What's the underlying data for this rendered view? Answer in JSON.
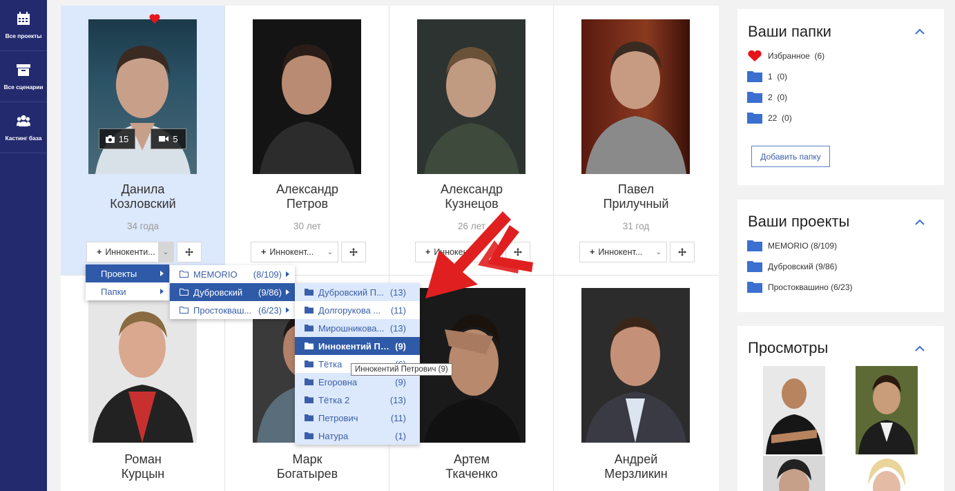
{
  "sidebar": {
    "items": [
      {
        "label": "Все проекты",
        "icon": "calendar-icon"
      },
      {
        "label": "Все сценарии",
        "icon": "archive-icon"
      },
      {
        "label": "Кастинг база",
        "icon": "users-icon"
      }
    ]
  },
  "actors": [
    {
      "name1": "Данила",
      "name2": "Козловский",
      "age": "34 года",
      "photos": "15",
      "videos": "5",
      "favorite": true
    },
    {
      "name1": "Александр",
      "name2": "Петров",
      "age": "30 лет"
    },
    {
      "name1": "Александр",
      "name2": "Кузнецов",
      "age": "26 лет"
    },
    {
      "name1": "Павел",
      "name2": "Прилучный",
      "age": "31 год"
    },
    {
      "name1": "Роман",
      "name2": "Курцын"
    },
    {
      "name1": "Марк",
      "name2": "Богатырев"
    },
    {
      "name1": "Артем",
      "name2": "Ткаченко"
    },
    {
      "name1": "Андрей",
      "name2": "Мерзликин"
    }
  ],
  "add_select_label": "Иннокенти...",
  "add_select_label2": "Иннокент...",
  "menu_level1": [
    {
      "label": "Проекты"
    },
    {
      "label": "Папки"
    }
  ],
  "menu_level2": [
    {
      "label": "MEMORIO",
      "count": "(8/109)"
    },
    {
      "label": "Дубровский",
      "count": "(9/86)"
    },
    {
      "label": "Простокваш...",
      "count": "(6/23)"
    }
  ],
  "menu_level3": [
    {
      "label": "Дубровский П...",
      "count": "(13)"
    },
    {
      "label": "Долгорукова ...",
      "count": "(11)"
    },
    {
      "label": "Мирошникова...",
      "count": "(13)"
    },
    {
      "label": "Иннокентий Пе...",
      "count": "(9)"
    },
    {
      "label": "Тётка",
      "count": "(6)"
    },
    {
      "label": "Егоровна",
      "count": "(9)"
    },
    {
      "label": "Тётка 2",
      "count": "(13)"
    },
    {
      "label": "Петрович",
      "count": "(11)"
    },
    {
      "label": "Натура",
      "count": "(1)"
    }
  ],
  "tooltip": "Иннокентий Петрович (9)",
  "folders_panel": {
    "title": "Ваши папки",
    "items": [
      {
        "label": "Избранное",
        "count": "(6)",
        "icon": "heart-icon"
      },
      {
        "label": "1",
        "count": "(0)",
        "icon": "folder-icon"
      },
      {
        "label": "2",
        "count": "(0)",
        "icon": "folder-icon"
      },
      {
        "label": "22",
        "count": "(0)",
        "icon": "folder-icon"
      }
    ],
    "add_button": "Добавить папку"
  },
  "projects_panel": {
    "title": "Ваши проекты",
    "items": [
      {
        "label": "MEMORIO (8/109)"
      },
      {
        "label": "Дубровский (9/86)"
      },
      {
        "label": "Простоквашино (6/23)"
      }
    ]
  },
  "views_panel": {
    "title": "Просмотры"
  },
  "colors": {
    "sidebar": "#232a6e",
    "accent": "#2f5aa8",
    "folder": "#3b6fd0",
    "heart": "#e8141b",
    "arrow": "#e02020"
  }
}
